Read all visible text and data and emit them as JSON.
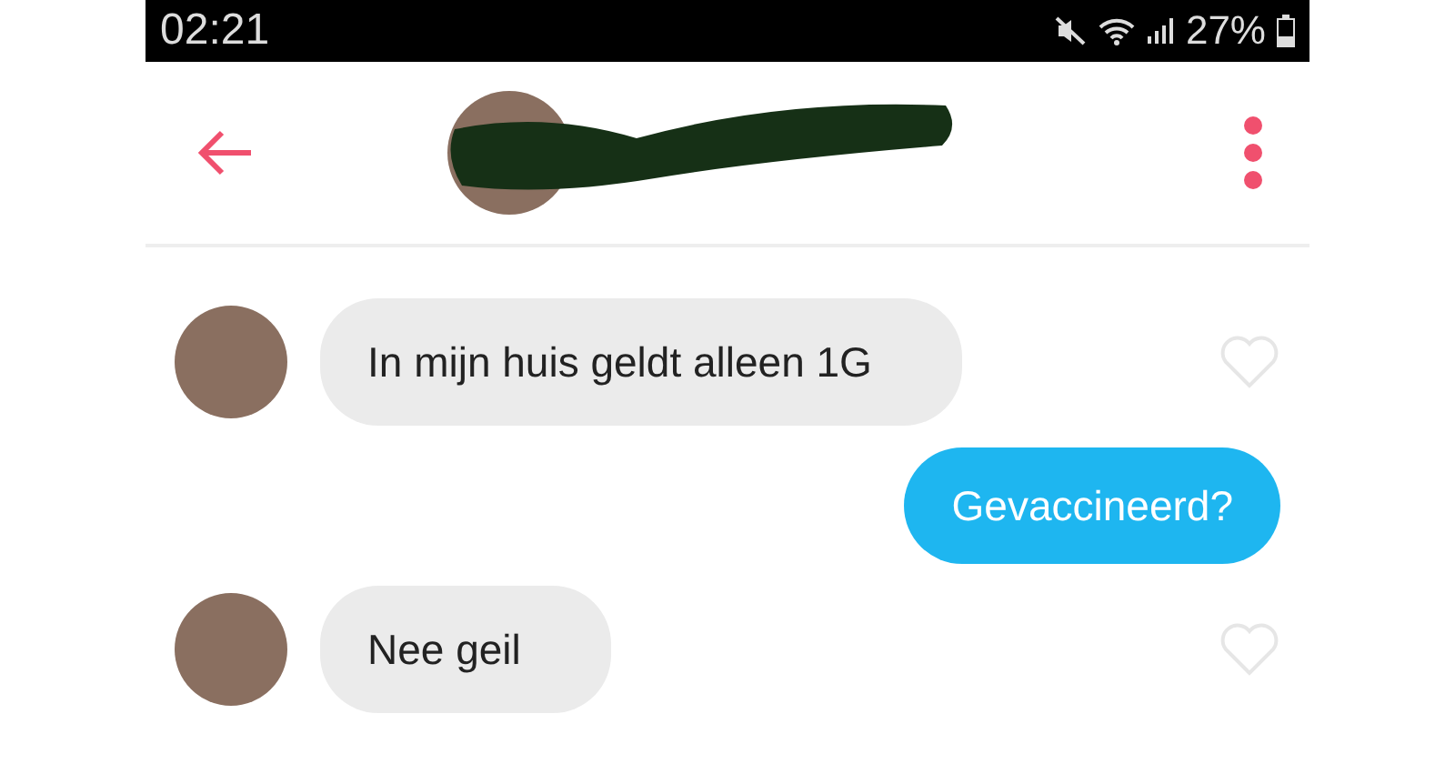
{
  "status_bar": {
    "time": "02:21",
    "battery": "27%"
  },
  "messages": [
    {
      "kind": "incoming",
      "text": "In mijn huis geldt alleen 1G",
      "liked": false
    },
    {
      "kind": "outgoing",
      "text": "Gevaccineerd?"
    },
    {
      "kind": "incoming",
      "text": "Nee geil",
      "liked": false
    }
  ]
}
